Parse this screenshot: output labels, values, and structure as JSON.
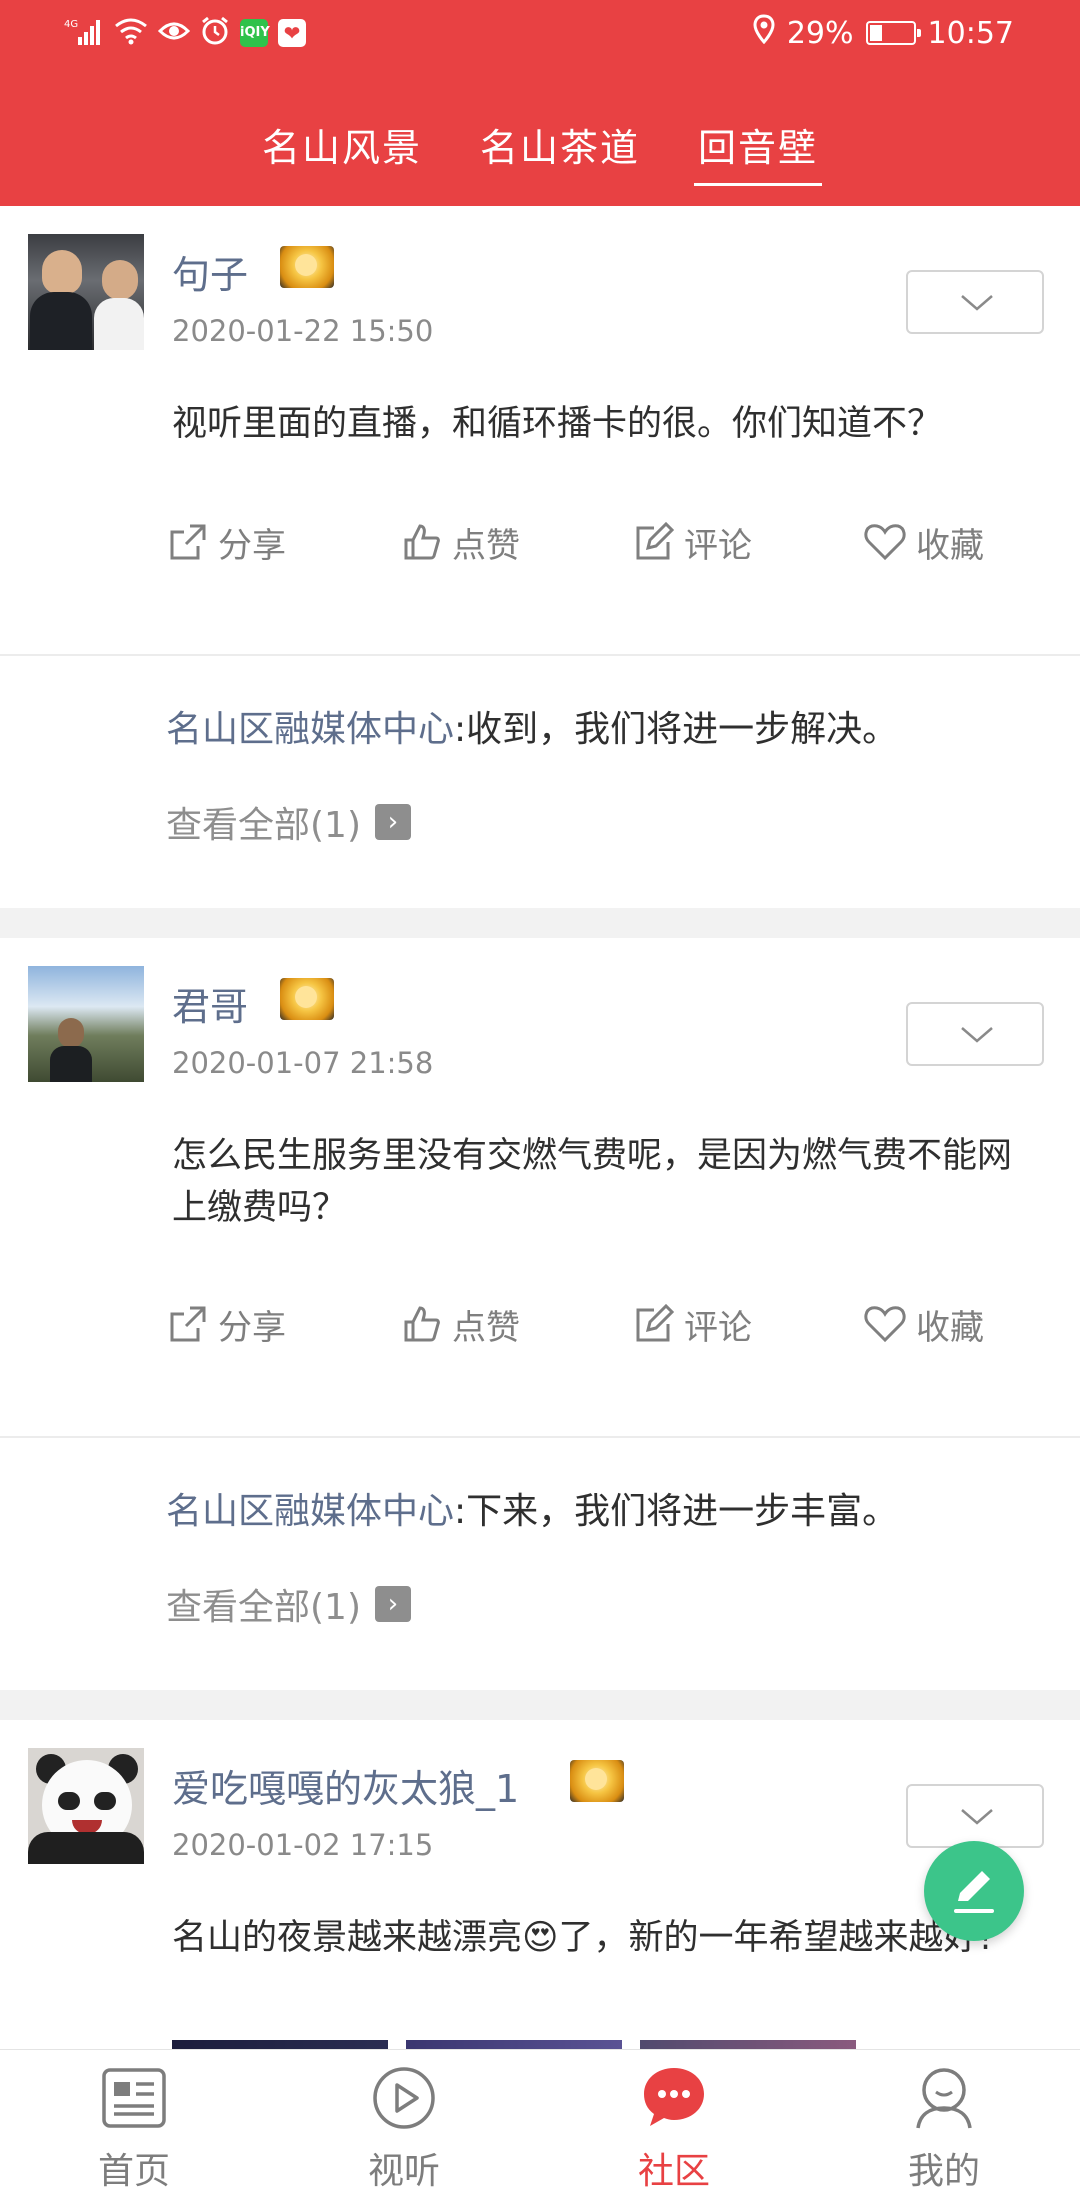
{
  "status_bar": {
    "network": "4G",
    "app_badge": "iQIY",
    "battery": "29%",
    "battery_level": 0.29,
    "time": "10:57"
  },
  "tabs": [
    {
      "label": "名山风景",
      "active": false
    },
    {
      "label": "名山茶道",
      "active": false
    },
    {
      "label": "回音壁",
      "active": true
    }
  ],
  "posts": [
    {
      "username": "句子",
      "date": "2020-01-22 15:50",
      "content": "视听里面的直播，和循环播卡的很。你们知道不？",
      "actions": {
        "share": "分享",
        "like": "点赞",
        "comment": "评论",
        "favorite": "收藏"
      },
      "reply": {
        "author": "名山区融媒体中心",
        "text": ":收到，我们将进一步解决。"
      },
      "view_all": "查看全部(1)"
    },
    {
      "username": "君哥",
      "date": "2020-01-07 21:58",
      "content": "怎么民生服务里没有交燃气费呢，是因为燃气费不能网上缴费吗？",
      "actions": {
        "share": "分享",
        "like": "点赞",
        "comment": "评论",
        "favorite": "收藏"
      },
      "reply": {
        "author": "名山区融媒体中心",
        "text": ":下来，我们将进一步丰富。"
      },
      "view_all": "查看全部(1)"
    },
    {
      "username": "爱吃嘎嘎的灰太狼_1",
      "date": "2020-01-02 17:15",
      "content": "名山的夜景越来越漂亮😍了，新的一年希望越来越好!"
    }
  ],
  "bottom_nav": [
    {
      "label": "首页",
      "icon": "news-icon",
      "active": false
    },
    {
      "label": "视听",
      "icon": "play-icon",
      "active": false
    },
    {
      "label": "社区",
      "icon": "chat-icon",
      "active": true
    },
    {
      "label": "我的",
      "icon": "user-icon",
      "active": false
    }
  ],
  "colors": {
    "brand_red": "#e84143",
    "username_blue": "#5e6e8c",
    "fab_green": "#3cc58a"
  }
}
